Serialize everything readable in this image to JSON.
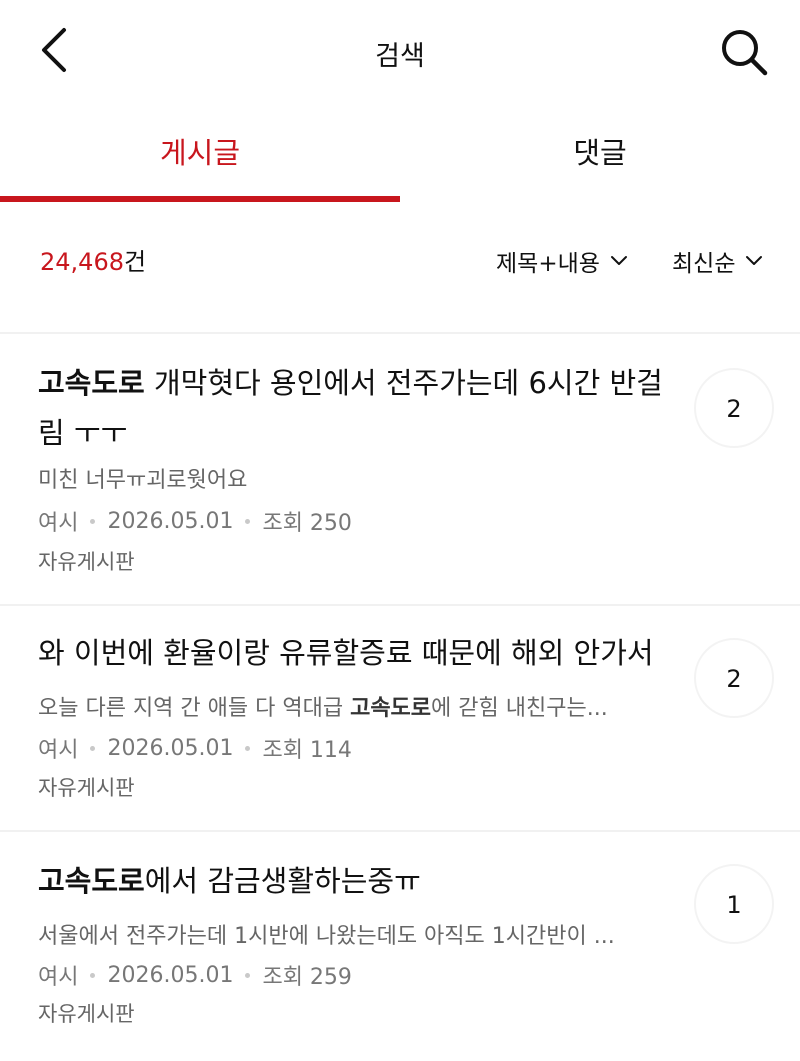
{
  "header": {
    "title": "검색",
    "back_icon": "chevron-left-icon",
    "search_icon": "search-icon"
  },
  "tabs": [
    {
      "label": "게시글",
      "active": true
    },
    {
      "label": "댓글",
      "active": false
    }
  ],
  "summary": {
    "count": "24,468",
    "count_unit": "건",
    "filter_field": "제목+내용",
    "filter_sort": "최신순"
  },
  "colors": {
    "accent": "#c8161d",
    "text": "#111111",
    "muted": "#777777"
  },
  "posts": [
    {
      "title_highlight": "고속도로",
      "title_rest": " 개막혓다 용인에서 전주가는데 6시간 반걸림 ㅜㅜ",
      "snippet_before": "미친 너무ㅠ괴로웟어요",
      "snippet_highlight": "",
      "snippet_after": "",
      "author": "여시",
      "date": "2026.05.01",
      "views": "조회 250",
      "board": "자유게시판",
      "comments": "2"
    },
    {
      "title_highlight": "",
      "title_rest": "와 이번에 환율이랑 유류할증료 때문에 해외 안가서",
      "snippet_before": "오늘 다른 지역 간 애들 다 역대급 ",
      "snippet_highlight": "고속도로",
      "snippet_after": "에 갇힘 내친구는...",
      "author": "여시",
      "date": "2026.05.01",
      "views": "조회 114",
      "board": "자유게시판",
      "comments": "2"
    },
    {
      "title_highlight": "고속도로",
      "title_rest": "에서 감금생활하는중ㅠ",
      "snippet_before": "서울에서 전주가는데 1시반에 나왔는데도 아직도 1시간반이 ...",
      "snippet_highlight": "",
      "snippet_after": "",
      "author": "여시",
      "date": "2026.05.01",
      "views": "조회 259",
      "board": "자유게시판",
      "comments": "1"
    }
  ]
}
